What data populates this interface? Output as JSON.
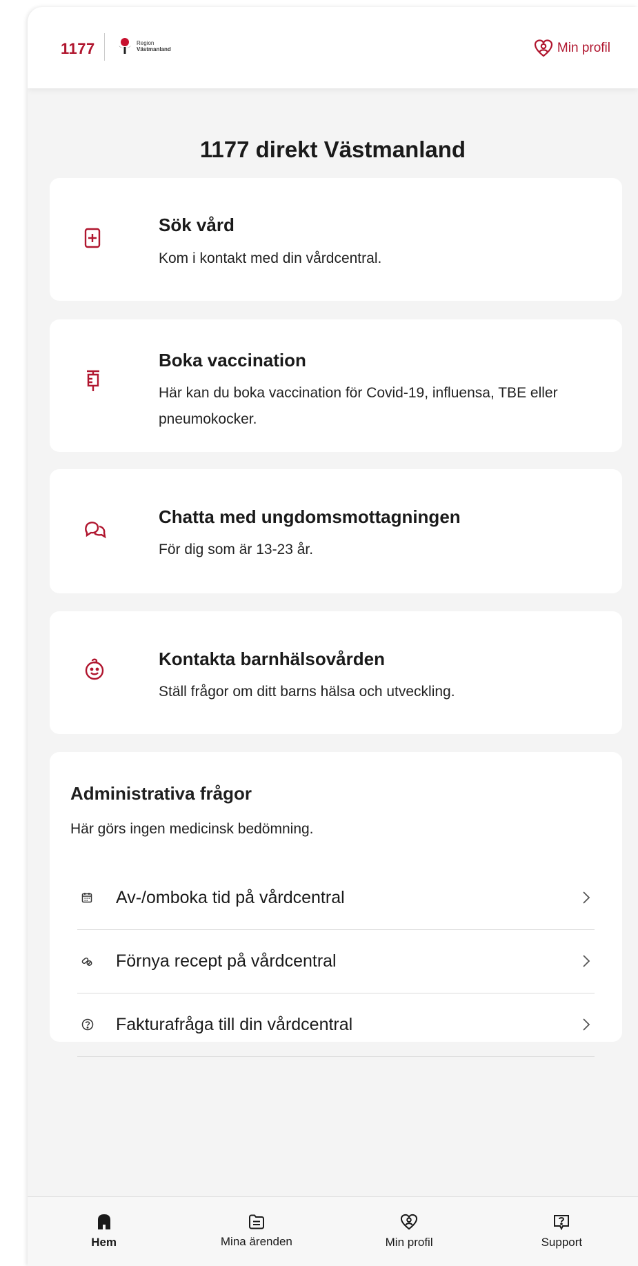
{
  "header": {
    "brand": "1177",
    "region_line1": "Region",
    "region_line2": "Västmanland",
    "profile_label": "Min profil"
  },
  "page_title": "1177 direkt Västmanland",
  "cards": [
    {
      "icon": "medical-plus-icon",
      "title": "Sök vård",
      "desc": "Kom i kontakt med din vårdcentral."
    },
    {
      "icon": "syringe-icon",
      "title": "Boka vaccination",
      "desc": "Här kan du boka vaccination för Covid-19, influensa, TBE eller pneumokocker."
    },
    {
      "icon": "chat-bubbles-icon",
      "title": "Chatta med ungdomsmottagningen",
      "desc": "För dig som är 13-23 år."
    },
    {
      "icon": "baby-face-icon",
      "title": "Kontakta barnhälsovården",
      "desc": "Ställ frågor om ditt barns hälsa och utveckling."
    }
  ],
  "admin": {
    "title": "Administrativa frågor",
    "subtitle": "Här görs ingen medicinsk bedömning.",
    "items": [
      {
        "icon": "calendar-icon",
        "label": "Av-/omboka tid på vårdcentral"
      },
      {
        "icon": "pill-icon",
        "label": "Förnya recept på vårdcentral"
      },
      {
        "icon": "question-circle-icon",
        "label": "Fakturafråga till din vårdcentral"
      }
    ]
  },
  "bottom_nav": [
    {
      "icon": "home-icon",
      "label": "Hem",
      "active": true
    },
    {
      "icon": "folder-icon",
      "label": "Mina ärenden"
    },
    {
      "icon": "profile-heart-icon",
      "label": "Min profil"
    },
    {
      "icon": "support-icon",
      "label": "Support"
    }
  ],
  "colors": {
    "accent": "#b0152e",
    "background": "#f4f4f4",
    "card": "#ffffff"
  }
}
